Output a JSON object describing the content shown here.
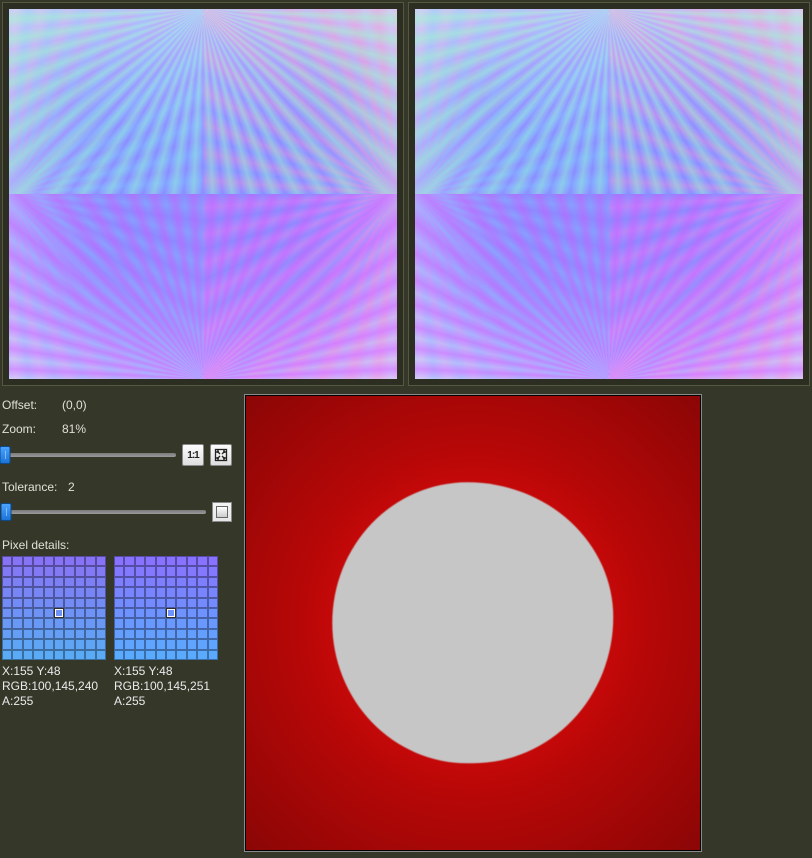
{
  "offset": {
    "label": "Offset:",
    "value": "(0,0)"
  },
  "zoom": {
    "label": "Zoom:",
    "value": "81%",
    "position_pct": 2
  },
  "tolerance": {
    "label": "Tolerance:",
    "value": "2",
    "position_pct": 2
  },
  "buttons": {
    "one_to_one_label": "1:1",
    "one_to_one_name": "one-to-one-icon",
    "fit_name": "fit-to-window-icon",
    "tolerance_swatch_name": "threshold-swatch-icon"
  },
  "pixel_details": {
    "header": "Pixel details:",
    "left": {
      "coord": "X:155 Y:48",
      "rgb": "RGB:100,145,240",
      "alpha": "A:255",
      "center_rgb": "#6491F0",
      "palette_base": "#7E7EF0"
    },
    "right": {
      "coord": "X:155 Y:48",
      "rgb": "RGB:100,145,251",
      "alpha": "A:255",
      "center_rgb": "#6491FB",
      "palette_base": "#7E7EFB"
    }
  },
  "colors": {
    "panel_bg": "#353729",
    "panel_inner": "#2c2e22",
    "border": "#55573f",
    "diff_red": "#d60808",
    "diff_blue": "#1018d6",
    "diff_grey": "#c6c6c6"
  }
}
